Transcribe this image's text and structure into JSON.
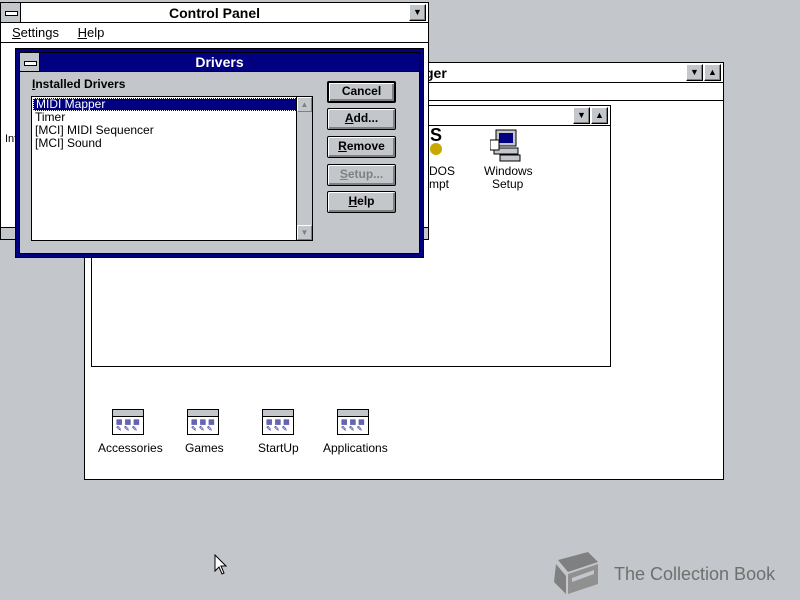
{
  "control_panel": {
    "title": "Control Panel",
    "menu": [
      {
        "label": "Settings",
        "u": "S",
        "rest": "ettings"
      },
      {
        "label": "Help",
        "u": "H",
        "rest": "elp"
      }
    ],
    "side_text": "Int"
  },
  "program_manager": {
    "title_fragment": "ger",
    "groups": [
      {
        "label": "Accessories"
      },
      {
        "label": "Games"
      },
      {
        "label": "StartUp"
      },
      {
        "label": "Applications"
      }
    ]
  },
  "main_group": {
    "dos_fragment_top": "DOS",
    "dos_fragment_bottom": "mpt",
    "dos_glyph": "S",
    "windows_setup_line1": "Windows",
    "windows_setup_line2": "Setup"
  },
  "drivers_dialog": {
    "title": "Drivers",
    "installed_label": "Installed Drivers",
    "installed_u": "I",
    "installed_rest": "nstalled Drivers",
    "drivers": [
      "MIDI Mapper",
      "Timer",
      "[MCI] MIDI Sequencer",
      "[MCI] Sound"
    ],
    "selected_index": 0,
    "buttons": {
      "cancel": "Cancel",
      "add_u": "A",
      "add_rest": "dd...",
      "remove_u": "R",
      "remove_rest": "emove",
      "setup_u": "S",
      "setup_rest": "etup...",
      "help_u": "H",
      "help_rest": "elp"
    }
  },
  "watermark": {
    "text": "The Collection Book"
  },
  "colors": {
    "desktop": "#c3c7cb",
    "active_title": "#000080",
    "window": "#ffffff"
  }
}
